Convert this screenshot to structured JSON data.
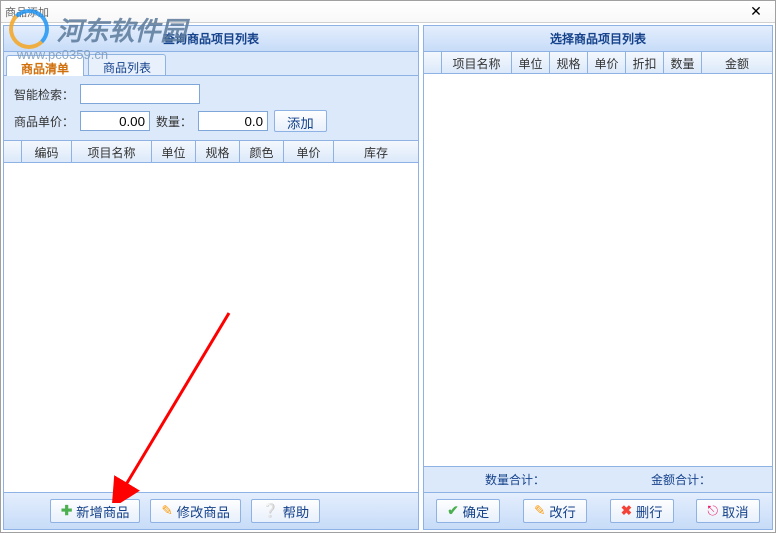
{
  "window": {
    "title": "商品添加"
  },
  "watermark": {
    "text": "河东软件园",
    "url": "www.pc0359.cn"
  },
  "left": {
    "header": "查询商品项目列表",
    "tabs": {
      "list_bill": "商品清单",
      "list_goods": "商品列表"
    },
    "search": {
      "smart_label": "智能检索：",
      "smart_value": "",
      "price_label": "商品单价：",
      "price_value": "0.00",
      "qty_label": "数量：",
      "qty_value": "0.0",
      "add_btn": "添加"
    },
    "columns": {
      "code": "编码",
      "name": "项目名称",
      "unit": "单位",
      "spec": "规格",
      "color": "颜色",
      "price": "单价",
      "stock": "库存"
    },
    "footer": {
      "new": "新增商品",
      "edit": "修改商品",
      "help": "帮助"
    }
  },
  "right": {
    "header": "选择商品项目列表",
    "columns": {
      "name": "项目名称",
      "unit": "单位",
      "spec": "规格",
      "price": "单价",
      "discount": "折扣",
      "qty": "数量",
      "amount": "金额"
    },
    "totals": {
      "qty_label": "数量合计：",
      "amount_label": "金额合计："
    },
    "footer": {
      "ok": "确定",
      "modify": "改行",
      "delete": "删行",
      "cancel": "取消"
    }
  }
}
